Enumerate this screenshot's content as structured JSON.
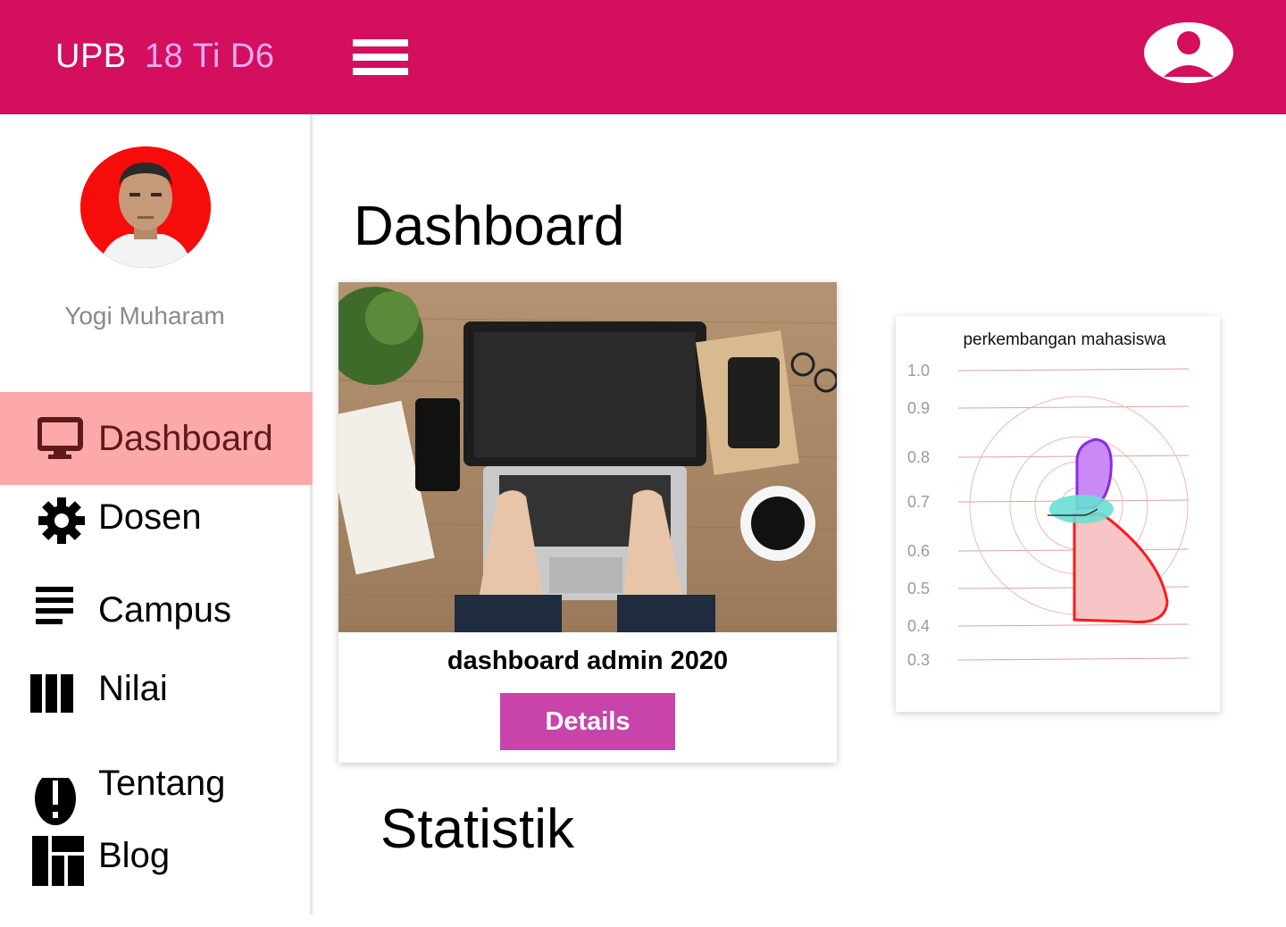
{
  "app": {
    "brand": "UPB",
    "brand_sub": "18 Ti D6"
  },
  "header": {
    "menu_icon": "hamburger-menu-icon",
    "user_icon": "account-circle-icon",
    "color": "#d30f5e"
  },
  "profile": {
    "name": "Yogi Muharam"
  },
  "sidebar": {
    "items": [
      {
        "label": "Dashboard",
        "icon": "monitor-icon",
        "active": true
      },
      {
        "label": "Dosen",
        "icon": "gear-icon",
        "active": false
      },
      {
        "label": "Campus",
        "icon": "lines-icon",
        "active": false
      },
      {
        "label": "Nilai",
        "icon": "columns-icon",
        "active": false
      },
      {
        "label": "Tentang",
        "icon": "alert-circle-icon",
        "active": false
      },
      {
        "label": "Blog",
        "icon": "dashboard-layout-icon",
        "active": false
      }
    ],
    "active_color": "#fda9a9"
  },
  "main": {
    "title": "Dashboard",
    "card": {
      "title": "dashboard admin 2020",
      "button_label": "Details",
      "button_color": "#c844ab"
    },
    "section_title": "Statistik"
  },
  "chart_data": {
    "type": "area",
    "title": "perkembangan mahasiswa",
    "y_ticks": [
      "1.0",
      "0.9",
      "0.8",
      "0.7",
      "0.6",
      "0.5",
      "0.4",
      "0.3"
    ],
    "grid": true,
    "series_colors": [
      "#8a2be2",
      "#ff1a1a",
      "#2fd6c2"
    ]
  }
}
